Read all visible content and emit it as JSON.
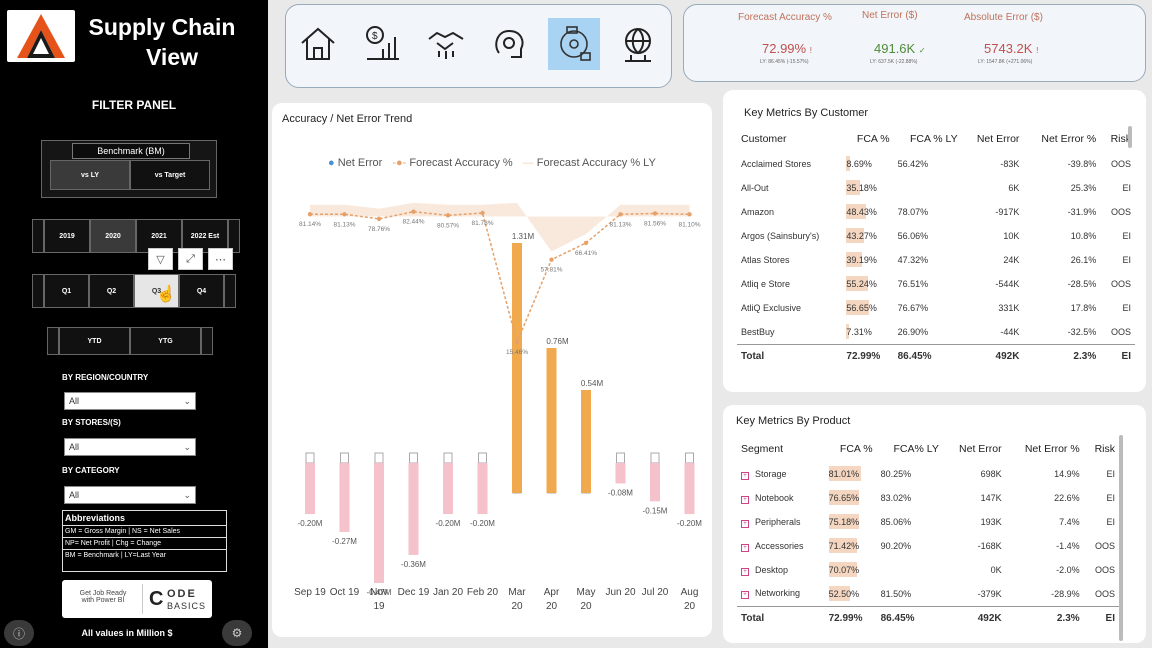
{
  "header": {
    "title_line1": "Supply Chain",
    "title_line2": "View",
    "filter_panel_title": "FILTER PANEL"
  },
  "benchmark": {
    "label": "Benchmark (BM)",
    "options": [
      "vs LY",
      "vs Target"
    ]
  },
  "years": [
    "2019",
    "2020",
    "2021",
    "2022 Est"
  ],
  "quarters": [
    "Q1",
    "Q2",
    "Q3",
    "Q4"
  ],
  "periods": [
    "YTD",
    "YTG"
  ],
  "filters": {
    "region": {
      "label": "BY REGION/COUNTRY",
      "value": "All"
    },
    "stores": {
      "label": "BY STORES/(S)",
      "value": "All"
    },
    "category": {
      "label": "BY CATEGORY",
      "value": "All"
    }
  },
  "abbreviations": {
    "title": "Abbreviations",
    "lines": [
      "GM = Gross Margin | NS = Net Sales",
      "NP= Net Profit | Chg = Change",
      "BM = Benchmark | LY=Last Year"
    ]
  },
  "promo": {
    "line1": "Get Job Ready",
    "line2": "with Power BI",
    "brand1": "ODE",
    "brand2": "BASICS",
    "brand_letter": "C"
  },
  "footer_note": "All values in Million $",
  "kpis": [
    {
      "label": "Forecast Accuracy %",
      "value": "72.99%",
      "sub": "LY: 86.45% (-15.57%)",
      "color": "#c0504d"
    },
    {
      "label": "Net Error ($)",
      "value": "491.6K",
      "sub": "LY: 637.5K (-22.88%)",
      "color": "#4f8a3a"
    },
    {
      "label": "Absolute Error ($)",
      "value": "5743.2K",
      "sub": "LY: 1547.8K (+271.06%)",
      "color": "#c0504d"
    }
  ],
  "trend": {
    "title": "Accuracy / Net Error Trend",
    "legend": [
      "Net Error",
      "Forecast Accuracy %",
      "Forecast Accuracy % LY"
    ]
  },
  "chart_data": {
    "type": "bar",
    "title": "Accuracy / Net Error Trend",
    "categories": [
      "Sep 19",
      "Oct 19",
      "Nov 19",
      "Dec 19",
      "Jan 20",
      "Feb 20",
      "Mar 20",
      "Apr 20",
      "May 20",
      "Jun 20",
      "Jul 20",
      "Aug 20"
    ],
    "series": [
      {
        "name": "Net Error",
        "values": [
          -0.2,
          -0.27,
          -0.47,
          -0.36,
          -0.2,
          -0.2,
          1.31,
          0.76,
          0.54,
          -0.08,
          -0.15,
          -0.2
        ],
        "labels": [
          "-0.20M",
          "-0.27M",
          "-0.47M",
          "-0.36M",
          "-0.20M",
          "-0.20M",
          "1.31M",
          "0.76M",
          "0.54M",
          "-0.08M",
          "-0.15M",
          "-0.20M"
        ]
      },
      {
        "name": "Forecast Accuracy %",
        "values": [
          81.14,
          81.13,
          78.76,
          82.44,
          80.57,
          81.78,
          15.46,
          57.81,
          66.41,
          81.13,
          81.56,
          81.1
        ],
        "labels": [
          "81.14%",
          "81.13%",
          "78.76%",
          "82.44%",
          "80.57%",
          "81.78%",
          "15.46%",
          "57.81%",
          "66.41%",
          "81.13%",
          "81.56%",
          "81.10%"
        ]
      },
      {
        "name": "Forecast Accuracy % LY",
        "values": [
          86,
          86,
          84,
          87,
          86,
          86,
          87,
          62,
          71,
          86,
          86,
          86
        ]
      }
    ]
  },
  "customer_table": {
    "title": "Key Metrics By Customer",
    "columns": [
      "Customer",
      "FCA %",
      "FCA % LY",
      "Net Error",
      "Net Error %",
      "Risk"
    ],
    "rows": [
      [
        "Acclaimed Stores",
        "8.69%",
        "56.42%",
        "-83K",
        "-39.8%",
        "OOS"
      ],
      [
        "All-Out",
        "35.18%",
        "",
        "6K",
        "25.3%",
        "EI"
      ],
      [
        "Amazon",
        "48.43%",
        "78.07%",
        "-917K",
        "-31.9%",
        "OOS"
      ],
      [
        "Argos (Sainsbury's)",
        "43.27%",
        "56.06%",
        "10K",
        "10.8%",
        "EI"
      ],
      [
        "Atlas Stores",
        "39.19%",
        "47.32%",
        "24K",
        "26.1%",
        "EI"
      ],
      [
        "Atliq e Store",
        "55.24%",
        "76.51%",
        "-544K",
        "-28.5%",
        "OOS"
      ],
      [
        "AtliQ Exclusive",
        "56.65%",
        "76.67%",
        "331K",
        "17.8%",
        "EI"
      ],
      [
        "BestBuy",
        "7.31%",
        "26.90%",
        "-44K",
        "-32.5%",
        "OOS"
      ]
    ],
    "total": [
      "Total",
      "72.99%",
      "86.45%",
      "492K",
      "2.3%",
      "EI"
    ]
  },
  "product_table": {
    "title": "Key Metrics By Product",
    "columns": [
      "Segment",
      "FCA %",
      "FCA% LY",
      "Net Error",
      "Net Error %",
      "Risk"
    ],
    "rows": [
      [
        "Storage",
        "81.01%",
        "80.25%",
        "698K",
        "14.9%",
        "EI"
      ],
      [
        "Notebook",
        "76.65%",
        "83.02%",
        "147K",
        "22.6%",
        "EI"
      ],
      [
        "Peripherals",
        "75.18%",
        "85.06%",
        "193K",
        "7.4%",
        "EI"
      ],
      [
        "Accessories",
        "71.42%",
        "90.20%",
        "-168K",
        "-1.4%",
        "OOS"
      ],
      [
        "Desktop",
        "70.07%",
        "",
        "0K",
        "-2.0%",
        "OOS"
      ],
      [
        "Networking",
        "52.50%",
        "81.50%",
        "-379K",
        "-28.9%",
        "OOS"
      ]
    ],
    "total": [
      "Total",
      "72.99%",
      "86.45%",
      "492K",
      "2.3%",
      "EI"
    ]
  },
  "colors": {
    "accent_orange": "#f0a94d",
    "pink_bar": "#f5c2cb",
    "nav_active": "#a9d3f3",
    "line": "#e6a16a"
  }
}
